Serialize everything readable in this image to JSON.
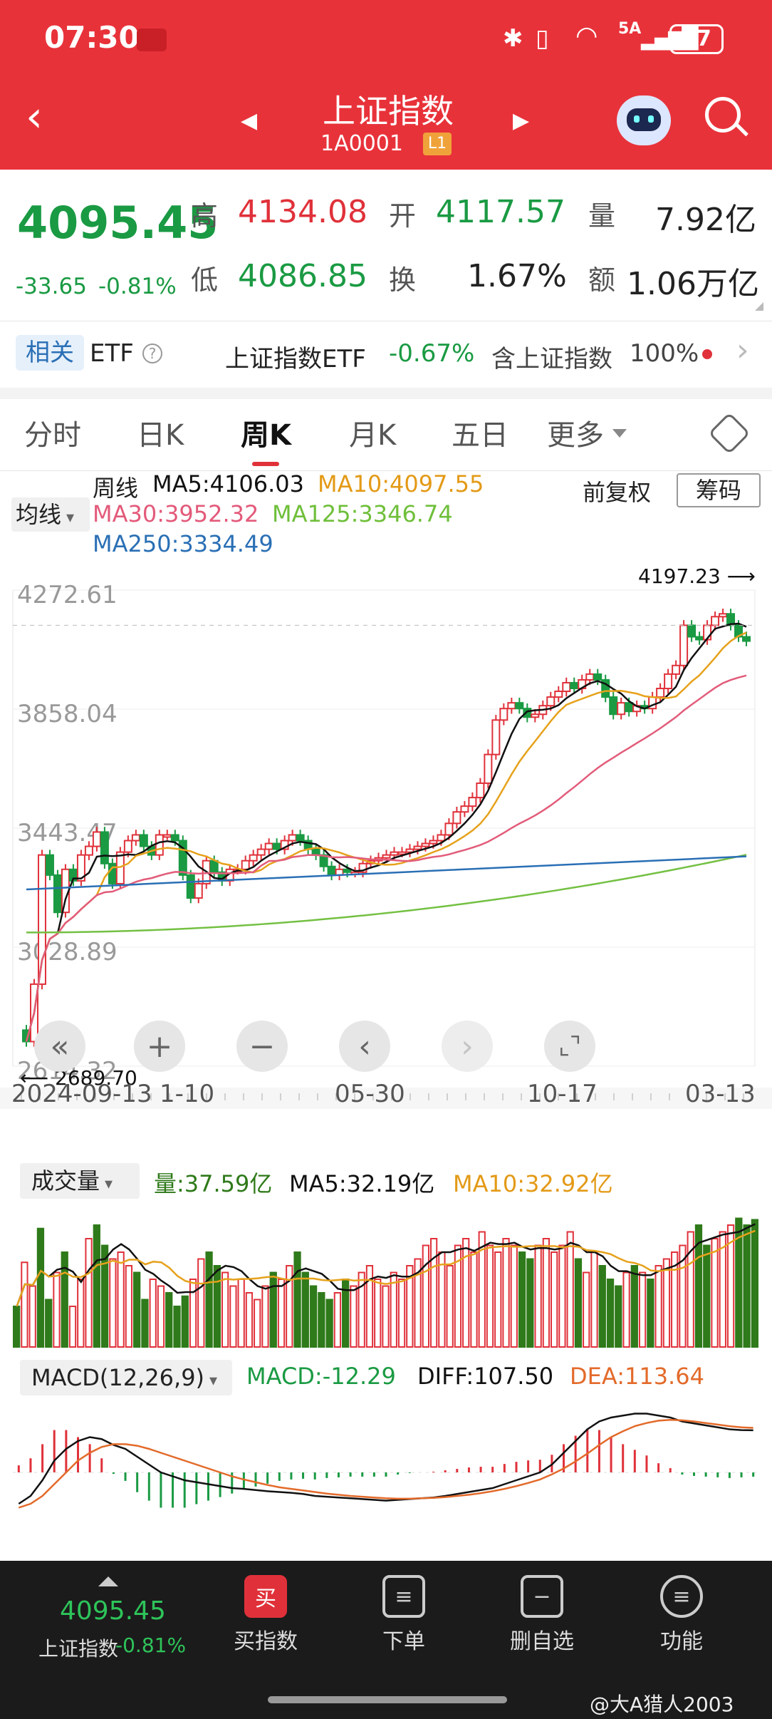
{
  "status": {
    "time": "07:30",
    "network": "5A",
    "battery": "57"
  },
  "nav": {
    "title": "上证指数",
    "code": "1A0001",
    "level": "L1"
  },
  "quote": {
    "price": "4095.45",
    "change": "-33.65",
    "pct": "-0.81%",
    "high_label": "高",
    "high": "4134.08",
    "open_label": "开",
    "open": "4117.57",
    "vol_label": "量",
    "vol": "7.92亿",
    "low_label": "低",
    "low": "4086.85",
    "turn_label": "换",
    "turn": "1.67%",
    "amt_label": "额",
    "amt": "1.06万亿"
  },
  "related": {
    "tag": "相关",
    "etf": "ETF",
    "name": "上证指数ETF",
    "pct": "-0.67%",
    "contains": "含上证指数",
    "ratio": "100%"
  },
  "tabs": [
    "分时",
    "日K",
    "周K",
    "月K",
    "五日",
    "更多"
  ],
  "active_tab": 2,
  "chart_header": {
    "ma_dropdown": "均线",
    "period": "周线",
    "ma5": "MA5:4106.03",
    "ma10": "MA10:4097.55",
    "ma30": "MA30:3952.32",
    "ma125": "MA125:3346.74",
    "ma250": "MA250:3334.49",
    "adjust": "前复权",
    "chip": "筹码"
  },
  "volume_header": {
    "dropdown": "成交量",
    "vol": "量:37.59亿",
    "ma5": "MA5:32.19亿",
    "ma10": "MA10:32.92亿"
  },
  "macd_header": {
    "dropdown": "MACD(12,26,9)",
    "macd": "MACD:-12.29",
    "diff": "DIFF:107.50",
    "dea": "DEA:113.64"
  },
  "bottom": {
    "price": "4095.45",
    "name": "上证指数",
    "pct": "-0.81%",
    "buy": "买指数",
    "order": "下单",
    "remove": "删自选",
    "func": "功能"
  },
  "watermark": "@大A猎人2003",
  "colors": {
    "up": "#e0313a",
    "down": "#1a9a43",
    "header": "#e8323a",
    "ma5": "#111111",
    "ma10": "#e6a21c",
    "ma30": "#e25c7a",
    "ma125": "#74c043",
    "ma250": "#2a6fb5"
  },
  "chart_data": {
    "type": "candlestick",
    "y_ticks": [
      "4272.61",
      "3858.04",
      "3443.47",
      "3028.89",
      "2614.32"
    ],
    "x_ticks": [
      "2024-09-13",
      "1-10",
      "05-30",
      "10-17",
      "03-13"
    ],
    "max_label": "4197.23",
    "min_label": "2689.70",
    "ylim": [
      2614.32,
      4272.61
    ],
    "closes": [
      2700,
      2900,
      3350,
      3280,
      3150,
      3300,
      3260,
      3350,
      3380,
      3430,
      3320,
      3250,
      3360,
      3400,
      3420,
      3380,
      3350,
      3420,
      3420,
      3400,
      3280,
      3200,
      3250,
      3330,
      3290,
      3260,
      3300,
      3300,
      3330,
      3350,
      3370,
      3390,
      3370,
      3400,
      3420,
      3400,
      3370,
      3350,
      3310,
      3280,
      3300,
      3290,
      3290,
      3320,
      3330,
      3340,
      3350,
      3360,
      3360,
      3370,
      3380,
      3390,
      3400,
      3420,
      3460,
      3500,
      3520,
      3550,
      3600,
      3700,
      3820,
      3860,
      3880,
      3860,
      3830,
      3840,
      3870,
      3900,
      3920,
      3950,
      3930,
      3960,
      3980,
      3960,
      3900,
      3840,
      3880,
      3850,
      3870,
      3860,
      3900,
      3930,
      3980,
      4010,
      4150,
      4110,
      4100,
      4150,
      4180,
      4190,
      4150,
      4110,
      4095
    ],
    "volume": [
      12,
      25,
      18,
      35,
      14,
      22,
      28,
      12,
      20,
      32,
      36,
      30,
      26,
      28,
      24,
      22,
      14,
      20,
      18,
      16,
      12,
      15,
      20,
      26,
      28,
      24,
      22,
      18,
      20,
      16,
      14,
      18,
      22,
      20,
      24,
      28,
      22,
      18,
      16,
      14,
      16,
      20,
      18,
      22,
      24,
      20,
      18,
      22,
      20,
      24,
      26,
      30,
      32,
      28,
      24,
      30,
      32,
      28,
      34,
      30,
      28,
      32,
      30,
      28,
      26,
      30,
      32,
      28,
      30,
      34,
      26,
      22,
      28,
      24,
      20,
      18,
      22,
      24,
      22,
      20,
      24,
      26,
      28,
      30,
      34,
      36,
      30,
      32,
      34,
      36,
      38,
      36,
      37.59
    ],
    "macd_diff": [
      -80,
      -60,
      -20,
      30,
      60,
      80,
      90,
      85,
      70,
      60,
      40,
      20,
      0,
      -10,
      -20,
      -25,
      -30,
      -35,
      -40,
      -42,
      -45,
      -48,
      -50,
      -52,
      -55,
      -60,
      -62,
      -64,
      -66,
      -68,
      -70,
      -72,
      -70,
      -68,
      -66,
      -64,
      -60,
      -55,
      -50,
      -45,
      -40,
      -30,
      -20,
      -10,
      0,
      20,
      50,
      80,
      110,
      130,
      140,
      145,
      150,
      150,
      145,
      140,
      130,
      125,
      120,
      115,
      110,
      108,
      107.5
    ],
    "macd_dea": [
      -90,
      -80,
      -60,
      -30,
      0,
      30,
      50,
      65,
      72,
      72,
      68,
      60,
      50,
      40,
      30,
      20,
      10,
      0,
      -10,
      -18,
      -25,
      -32,
      -38,
      -42,
      -46,
      -50,
      -54,
      -57,
      -60,
      -62,
      -64,
      -66,
      -67,
      -67,
      -66,
      -65,
      -63,
      -60,
      -57,
      -53,
      -48,
      -42,
      -35,
      -27,
      -18,
      -5,
      10,
      28,
      48,
      70,
      90,
      105,
      118,
      126,
      132,
      134,
      133,
      130,
      126,
      122,
      118,
      115,
      113.64
    ]
  }
}
